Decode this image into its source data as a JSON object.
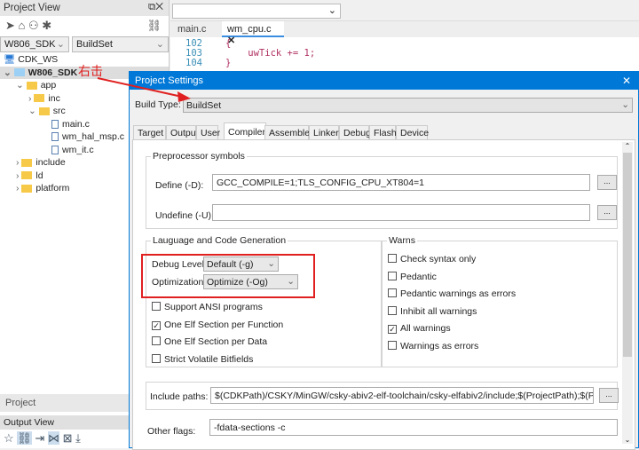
{
  "project_view": {
    "title": "Project View",
    "workspace_select": "W806_SDK",
    "build_select": "BuildSet",
    "tree": [
      {
        "label": "CDK_WS",
        "level": 0,
        "kind": "workspace"
      },
      {
        "label": "W806_SDK",
        "level": 0,
        "kind": "project"
      },
      {
        "label": "app",
        "level": 1,
        "kind": "folder"
      },
      {
        "label": "inc",
        "level": 2,
        "kind": "folder"
      },
      {
        "label": "src",
        "level": 2,
        "kind": "folder"
      },
      {
        "label": "main.c",
        "level": 3,
        "kind": "file"
      },
      {
        "label": "wm_hal_msp.c",
        "level": 3,
        "kind": "file"
      },
      {
        "label": "wm_it.c",
        "level": 3,
        "kind": "file"
      },
      {
        "label": "include",
        "level": 1,
        "kind": "folder"
      },
      {
        "label": "ld",
        "level": 1,
        "kind": "folder"
      },
      {
        "label": "platform",
        "level": 1,
        "kind": "folder"
      }
    ],
    "bottom_tab": "Project"
  },
  "output_view": {
    "title": "Output View"
  },
  "editor": {
    "tabs": [
      "main.c",
      "wm_cpu.c"
    ],
    "active_tab": "wm_cpu.c",
    "lines": [
      {
        "n": "102",
        "code": "{"
      },
      {
        "n": "103",
        "code": "    uwTick += 1;"
      },
      {
        "n": "104",
        "code": "}"
      }
    ]
  },
  "annotation": {
    "text": "右击",
    "color": "#e02020"
  },
  "dialog": {
    "title": "Project Settings",
    "build_type_label": "Build Type:",
    "build_type": "BuildSet",
    "tabs": [
      "Target",
      "Output",
      "User",
      "Compiler",
      "Assembler",
      "Linker",
      "Debug",
      "Flash",
      "Device"
    ],
    "active_tab": "Compiler",
    "preprocessor": {
      "title": "Preprocessor symbols",
      "define_label": "Define (-D):",
      "define": "GCC_COMPILE=1;TLS_CONFIG_CPU_XT804=1",
      "undefine_label": "Undefine (-U):",
      "undefine": "",
      "browse": "..."
    },
    "language": {
      "title": "Lauguage and Code Generation",
      "debug_label": "Debug Level:",
      "debug_value": "Default (-g)",
      "opt_label": "Optimization:",
      "opt_value": "Optimize (-Og)",
      "options": [
        {
          "label": "Support ANSI programs",
          "checked": false
        },
        {
          "label": "One Elf Section per Function",
          "checked": true
        },
        {
          "label": "One Elf Section per Data",
          "checked": false
        },
        {
          "label": "Strict Volatile Bitfields",
          "checked": false
        }
      ]
    },
    "warns": {
      "title": "Warns",
      "options": [
        {
          "label": "Check syntax only",
          "checked": false
        },
        {
          "label": "Pedantic",
          "checked": false
        },
        {
          "label": "Pedantic warnings as errors",
          "checked": false
        },
        {
          "label": "Inhibit all warnings",
          "checked": false
        },
        {
          "label": "All warnings",
          "checked": true
        },
        {
          "label": "Warnings as errors",
          "checked": false
        }
      ]
    },
    "include_label": "Include paths:",
    "include_paths": "$(CDKPath)/CSKY/MinGW/csky-abiv2-elf-toolchain/csky-elfabiv2/include;$(ProjectPath);$(ProjectPath)/..",
    "other_flags_label": "Other flags:",
    "other_flags": "-fdata-sections -c"
  }
}
